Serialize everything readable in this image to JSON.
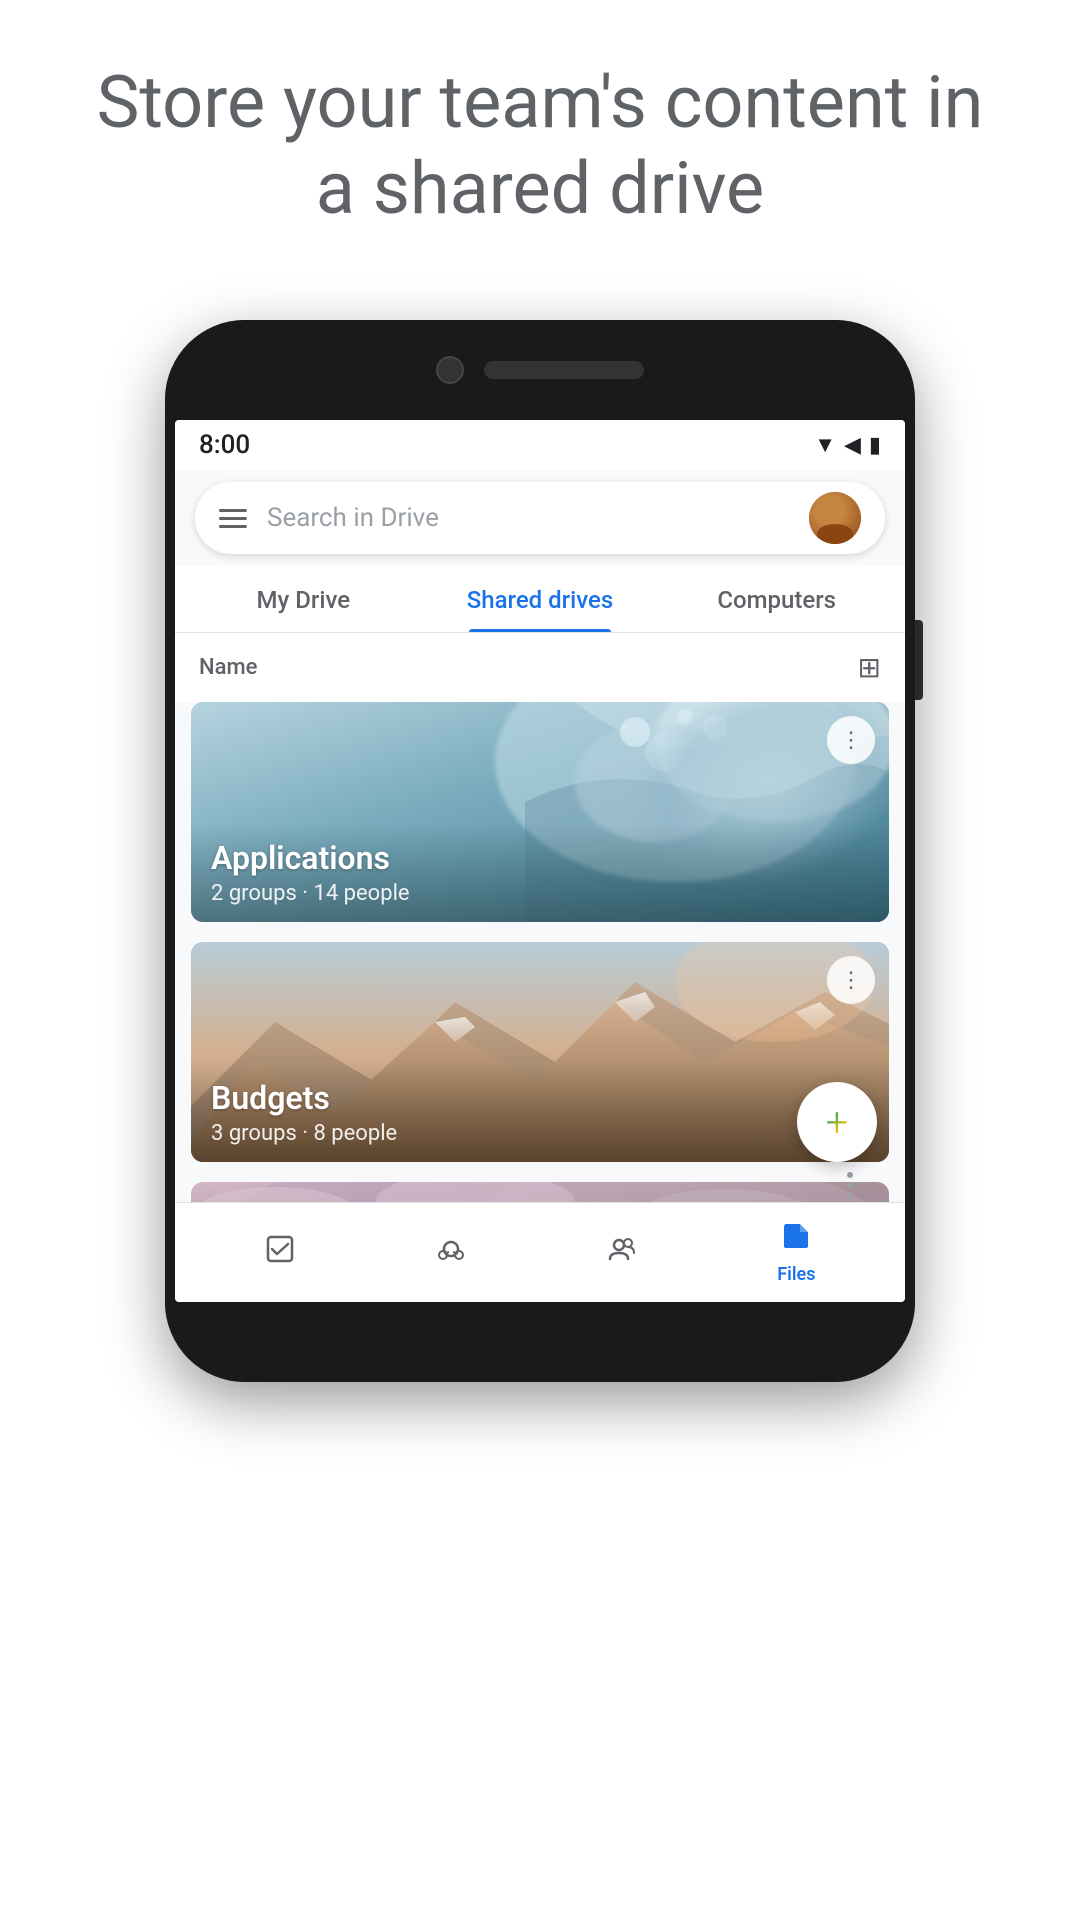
{
  "hero": {
    "title": "Store your team's content in a shared drive"
  },
  "status_bar": {
    "time": "8:00",
    "icons": [
      "wifi",
      "signal",
      "battery"
    ]
  },
  "search": {
    "placeholder": "Search in Drive"
  },
  "tabs": [
    {
      "id": "my-drive",
      "label": "My Drive",
      "active": false
    },
    {
      "id": "shared-drives",
      "label": "Shared drives",
      "active": true
    },
    {
      "id": "computers",
      "label": "Computers",
      "active": false
    }
  ],
  "sort": {
    "label": "Name"
  },
  "cards": [
    {
      "id": "applications",
      "title": "Applications",
      "subtitle": "2 groups · 14 people",
      "bg_type": "applications"
    },
    {
      "id": "budgets",
      "title": "Budgets",
      "subtitle": "3 groups · 8 people",
      "bg_type": "budgets"
    },
    {
      "id": "third",
      "title": "",
      "subtitle": "",
      "bg_type": "third"
    }
  ],
  "bottom_nav": [
    {
      "id": "tasks",
      "icon": "☑",
      "label": ""
    },
    {
      "id": "activity",
      "icon": "⊕",
      "label": ""
    },
    {
      "id": "shared",
      "icon": "👥",
      "label": ""
    },
    {
      "id": "files",
      "icon": "📁",
      "label": "Files"
    }
  ],
  "fab": {
    "icon": "+"
  }
}
